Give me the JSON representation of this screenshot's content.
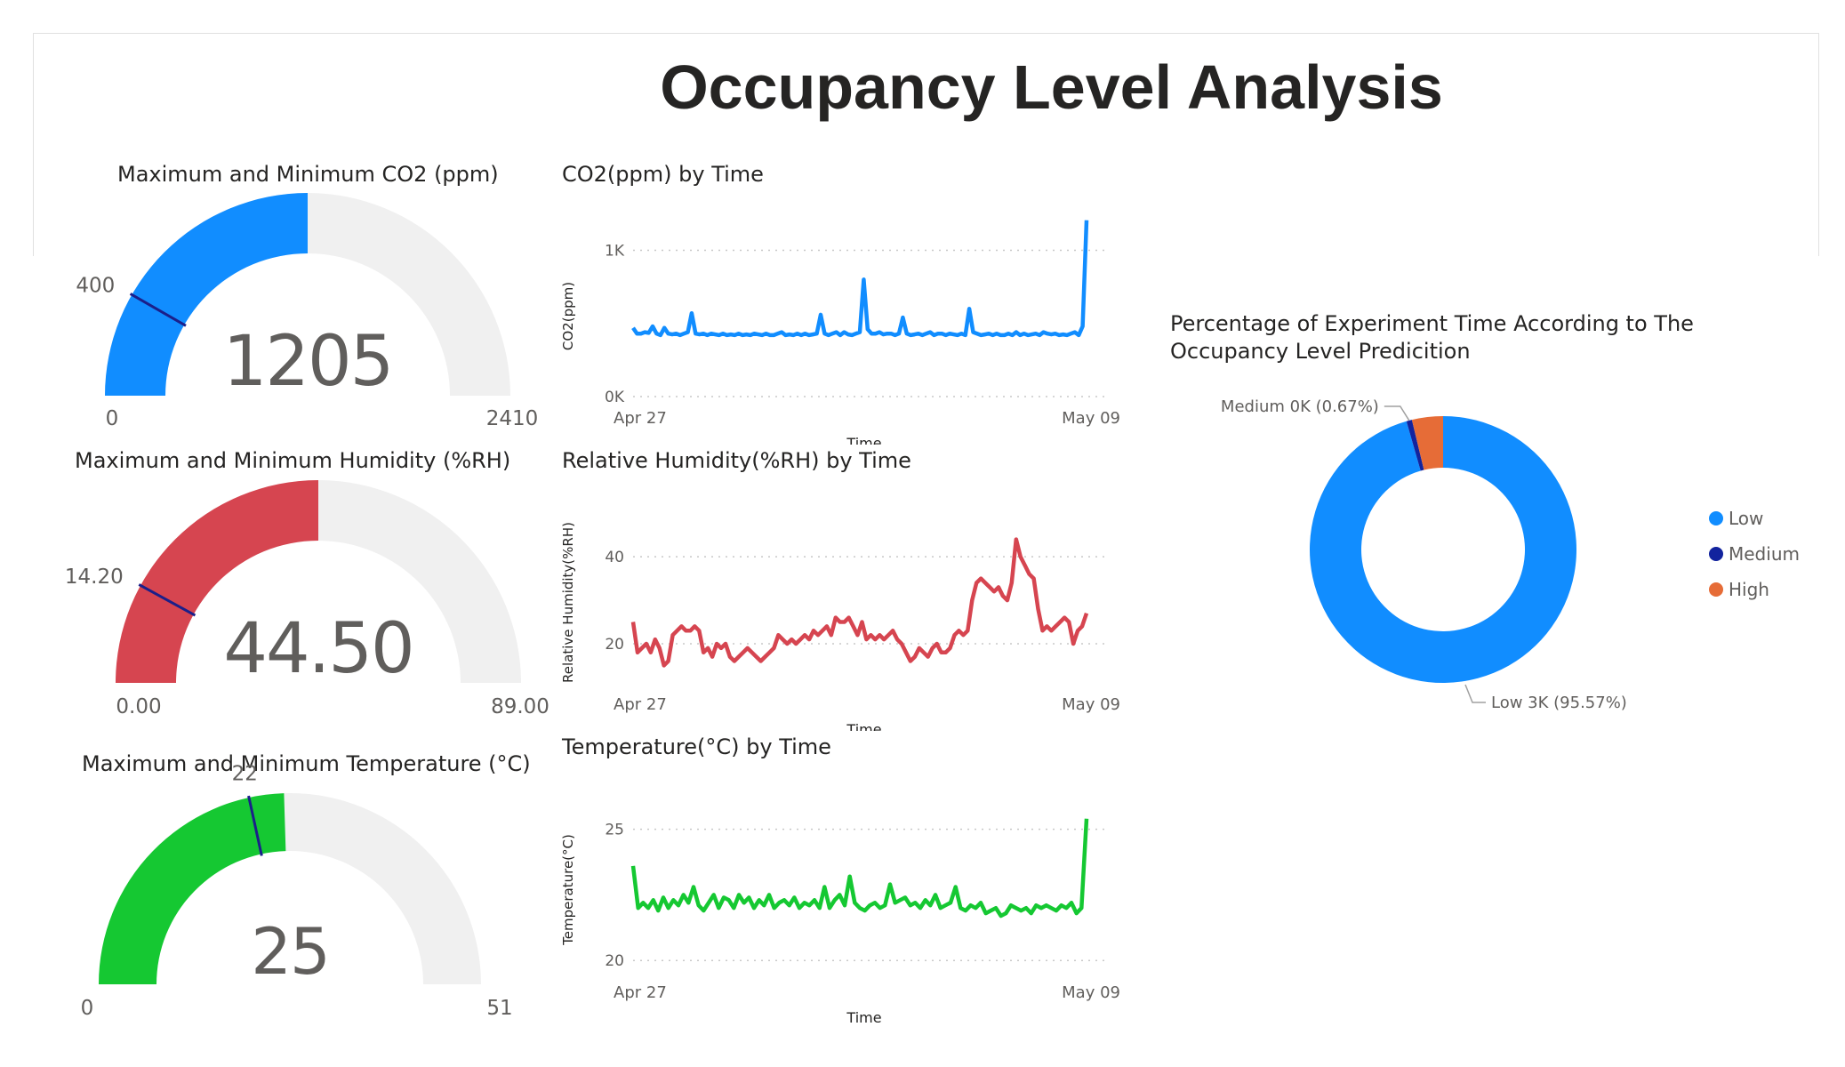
{
  "page_title": "Occupancy Level Analysis",
  "colors": {
    "co2": "#118dff",
    "humidity": "#d64550",
    "temperature": "#15c832",
    "target": "#1b1f8a",
    "track": "#f0f0f0",
    "low": "#118dff",
    "medium": "#12239e",
    "high": "#e66c37"
  },
  "chart_data": [
    {
      "type": "gauge",
      "title": "Maximum and Minimum CO2 (ppm)",
      "value": 1205,
      "value_label": "1205",
      "min": 0,
      "max": 2410,
      "min_label": "0",
      "max_label": "2410",
      "target": 400,
      "target_label": "400"
    },
    {
      "type": "gauge",
      "title": "Maximum and Minimum Humidity (%RH)",
      "value": 44.5,
      "value_label": "44.50",
      "min": 0,
      "max": 89,
      "min_label": "0.00",
      "max_label": "89.00",
      "target": 14.2,
      "target_label": "14.20"
    },
    {
      "type": "gauge",
      "title": "Maximum and Minimum Temperature (°C)",
      "value": 25,
      "value_label": "25",
      "min": 0,
      "max": 51,
      "min_label": "0",
      "max_label": "51",
      "target": 22,
      "target_label": "22"
    },
    {
      "type": "line",
      "title": "CO2(ppm) by Time",
      "xlabel": "Time",
      "ylabel": "CO2(ppm)",
      "x_ticks": [
        "Apr 27",
        "May 09"
      ],
      "y_ticks": [
        {
          "value": 0,
          "label": "0K"
        },
        {
          "value": 1000,
          "label": "1K"
        }
      ],
      "ylim": [
        0,
        1100
      ],
      "values": [
        470,
        430,
        430,
        440,
        435,
        480,
        430,
        420,
        470,
        430,
        425,
        430,
        420,
        430,
        440,
        570,
        430,
        425,
        430,
        420,
        430,
        425,
        420,
        430,
        420,
        425,
        420,
        430,
        420,
        425,
        420,
        430,
        425,
        420,
        430,
        420,
        420,
        430,
        440,
        420,
        425,
        420,
        430,
        420,
        430,
        420,
        425,
        430,
        560,
        430,
        420,
        430,
        440,
        420,
        440,
        425,
        420,
        430,
        440,
        800,
        460,
        430,
        430,
        440,
        425,
        430,
        430,
        420,
        430,
        540,
        430,
        420,
        425,
        430,
        420,
        430,
        440,
        420,
        430,
        430,
        420,
        430,
        425,
        420,
        430,
        420,
        600,
        440,
        430,
        420,
        425,
        430,
        420,
        430,
        420,
        420,
        430,
        420,
        440,
        420,
        430,
        420,
        425,
        430,
        420,
        440,
        430,
        425,
        430,
        420,
        425,
        420,
        430,
        440,
        420,
        480,
        1205
      ]
    },
    {
      "type": "line",
      "title": "Relative Humidity(%RH) by Time",
      "xlabel": "Time",
      "ylabel": "Relative Humidity(%RH)",
      "x_ticks": [
        "Apr 27",
        "May 09"
      ],
      "y_ticks": [
        {
          "value": 20,
          "label": "20"
        },
        {
          "value": 40,
          "label": "40"
        }
      ],
      "ylim": [
        11,
        48
      ],
      "values": [
        25,
        18,
        19,
        20,
        18,
        21,
        19,
        15,
        16,
        22,
        23,
        24,
        23,
        23,
        24,
        23,
        18,
        19,
        17,
        20,
        19,
        20,
        17,
        16,
        17,
        18,
        19,
        18,
        17,
        16,
        17,
        18,
        19,
        22,
        21,
        20,
        21,
        20,
        21,
        22,
        21,
        23,
        22,
        23,
        24,
        22,
        26,
        25,
        25,
        26,
        24,
        22,
        25,
        21,
        22,
        21,
        22,
        21,
        22,
        23,
        21,
        20,
        18,
        16,
        17,
        19,
        18,
        17,
        19,
        20,
        18,
        18,
        19,
        22,
        23,
        22,
        23,
        30,
        34,
        35,
        34,
        33,
        32,
        33,
        31,
        30,
        34,
        44,
        40,
        38,
        36,
        35,
        28,
        23,
        24,
        23,
        24,
        25,
        26,
        25,
        20,
        23,
        24,
        27
      ]
    },
    {
      "type": "line",
      "title": "Temperature(°C) by Time",
      "xlabel": "Time",
      "ylabel": "Temperature(°C)",
      "x_ticks": [
        "Apr 27",
        "May 09"
      ],
      "y_ticks": [
        {
          "value": 20,
          "label": "20"
        },
        {
          "value": 25,
          "label": "25"
        }
      ],
      "ylim": [
        19.6,
        25.8
      ],
      "values": [
        23.6,
        22.0,
        22.2,
        22.0,
        22.3,
        21.9,
        22.4,
        22.0,
        22.3,
        22.1,
        22.5,
        22.2,
        22.8,
        22.1,
        21.9,
        22.2,
        22.5,
        22.0,
        22.4,
        22.3,
        22.0,
        22.5,
        22.2,
        22.4,
        22.0,
        22.3,
        22.1,
        22.5,
        22.0,
        22.2,
        22.3,
        22.1,
        22.4,
        22.0,
        22.2,
        22.1,
        22.3,
        22.0,
        22.8,
        22.0,
        22.3,
        22.5,
        22.1,
        23.2,
        22.2,
        22.0,
        21.9,
        22.1,
        22.2,
        22.0,
        22.1,
        22.9,
        22.2,
        22.3,
        22.4,
        22.1,
        22.2,
        22.0,
        22.3,
        22.1,
        22.5,
        22.0,
        22.1,
        22.2,
        22.8,
        22.0,
        21.9,
        22.1,
        22.0,
        22.2,
        21.8,
        21.9,
        22.0,
        21.7,
        21.8,
        22.1,
        22.0,
        21.9,
        22.0,
        21.8,
        22.1,
        22.0,
        22.1,
        22.0,
        21.9,
        22.1,
        22.0,
        22.2,
        21.8,
        22.0,
        25.4
      ]
    },
    {
      "type": "pie",
      "title": "Percentage of Experiment Time According to The Occupancy Level Predicition",
      "slices": [
        {
          "name": "Low",
          "value": 95.57,
          "label": "Low 3K (95.57%)"
        },
        {
          "name": "Medium",
          "value": 0.67,
          "label": "Medium 0K (0.67%)"
        },
        {
          "name": "High",
          "value": 3.76,
          "label": ""
        }
      ]
    }
  ],
  "legend": [
    {
      "name": "Low"
    },
    {
      "name": "Medium"
    },
    {
      "name": "High"
    }
  ]
}
